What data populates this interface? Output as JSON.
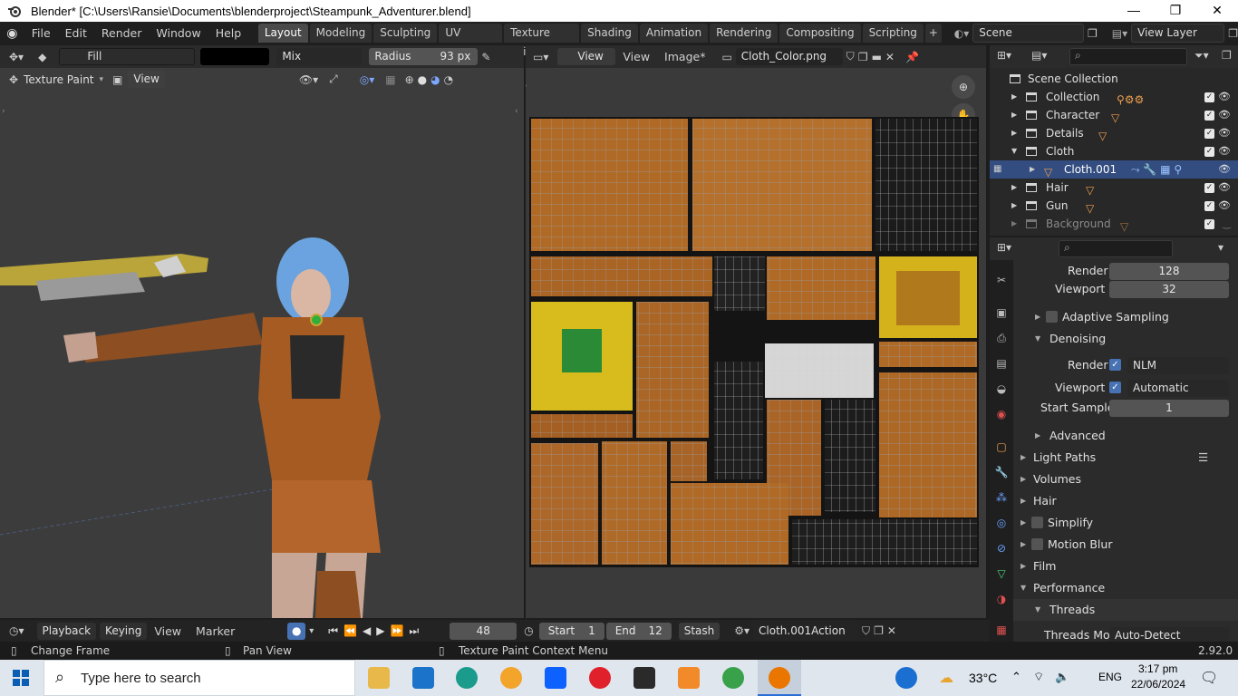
{
  "window": {
    "title": "Blender* [C:\\Users\\Ransie\\Documents\\blenderproject\\Steampunk_Adventurer.blend]",
    "minimize": "—",
    "maximize": "❐",
    "close": "✕"
  },
  "menu": {
    "items": [
      "File",
      "Edit",
      "Render",
      "Window",
      "Help"
    ]
  },
  "workspaces": {
    "tabs": [
      "Layout",
      "Modeling",
      "Sculpting",
      "UV Editing",
      "Texture Paint",
      "Shading",
      "Animation",
      "Rendering",
      "Compositing",
      "Scripting"
    ],
    "active": "Layout",
    "add": "+"
  },
  "scene": {
    "name": "Scene",
    "view_layer": "View Layer"
  },
  "viewport": {
    "brush_name": "Fill",
    "blend_mode": "Mix",
    "radius_label": "Radius",
    "radius_value": "93 px",
    "mode": "Texture Paint",
    "view_button": "View"
  },
  "uv_editor": {
    "view_menu": "View",
    "view_item": "View",
    "image_menu": "Image*",
    "image_name": "Cloth_Color.png"
  },
  "outliner": {
    "root": "Scene Collection",
    "rows": [
      {
        "label": "Collection",
        "expanded": false
      },
      {
        "label": "Character",
        "expanded": false
      },
      {
        "label": "Details",
        "expanded": false
      },
      {
        "label": "Cloth",
        "expanded": true
      },
      {
        "label": "Cloth.001",
        "expanded": false,
        "selected": true
      },
      {
        "label": "Hair",
        "expanded": false
      },
      {
        "label": "Gun",
        "expanded": false
      },
      {
        "label": "Background",
        "expanded": false,
        "dim": true
      }
    ]
  },
  "properties": {
    "render_label": "Render",
    "render_value": "128",
    "viewport_label": "Viewport",
    "viewport_value": "32",
    "adaptive_sampling": "Adaptive Sampling",
    "denoising": "Denoising",
    "denoise_render_label": "Render",
    "denoise_render_value": "NLM",
    "denoise_viewport_label": "Viewport",
    "denoise_viewport_value": "Automatic",
    "start_sample_label": "Start Sample",
    "start_sample_value": "1",
    "advanced": "Advanced",
    "light_paths": "Light Paths",
    "volumes": "Volumes",
    "hair": "Hair",
    "simplify": "Simplify",
    "motion_blur": "Motion Blur",
    "film": "Film",
    "performance": "Performance",
    "threads": "Threads",
    "threads_mode_label": "Threads Mode",
    "threads_mode_value": "Auto-Detect"
  },
  "timeline": {
    "playback": "Playback",
    "keying": "Keying",
    "view": "View",
    "marker": "Marker",
    "current_frame": "48",
    "start_label": "Start",
    "start_value": "1",
    "end_label": "End",
    "end_value": "12",
    "stash": "Stash",
    "action": "Cloth.001Action"
  },
  "status": {
    "left": "Change Frame",
    "middle": "Pan View",
    "right": "Texture Paint Context Menu",
    "version": "2.92.0"
  },
  "taskbar": {
    "search_placeholder": "Type here to search",
    "temperature": "33°C",
    "language": "ENG",
    "time": "3:17 pm",
    "date": "22/06/2024"
  }
}
